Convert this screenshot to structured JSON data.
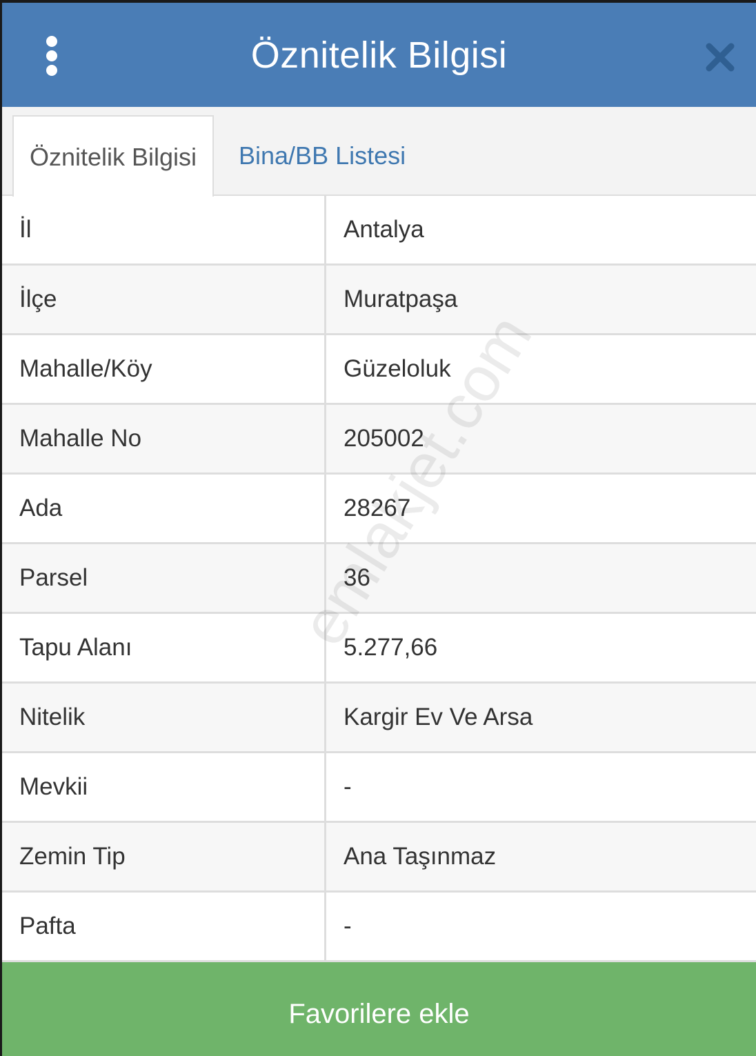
{
  "header": {
    "title": "Öznitelik Bilgisi",
    "menu_icon": "more-vertical-icon",
    "close_icon": "close-icon",
    "color": "#4a7db6"
  },
  "tabs": [
    {
      "label": "Öznitelik Bilgisi",
      "active": true
    },
    {
      "label": "Bina/BB Listesi",
      "active": false
    }
  ],
  "attributes": [
    {
      "label": "İl",
      "value": "Antalya"
    },
    {
      "label": "İlçe",
      "value": "Muratpaşa"
    },
    {
      "label": "Mahalle/Köy",
      "value": "Güzeloluk"
    },
    {
      "label": "Mahalle No",
      "value": "205002"
    },
    {
      "label": "Ada",
      "value": "28267"
    },
    {
      "label": "Parsel",
      "value": "36"
    },
    {
      "label": "Tapu Alanı",
      "value": "5.277,66"
    },
    {
      "label": "Nitelik",
      "value": "Kargir Ev Ve Arsa"
    },
    {
      "label": "Mevkii",
      "value": "-"
    },
    {
      "label": "Zemin Tip",
      "value": "Ana Taşınmaz"
    },
    {
      "label": "Pafta",
      "value": "-"
    }
  ],
  "watermark": "emlakjet.com",
  "footer": {
    "favorite_label": "Favorilere ekle",
    "color": "#6fb46a"
  }
}
